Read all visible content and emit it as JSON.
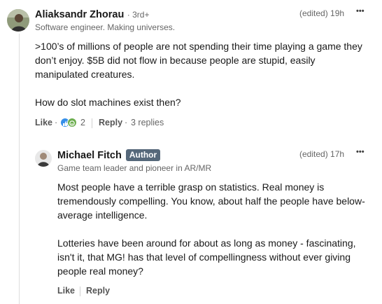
{
  "comment": {
    "author": "Aliaksandr Zhorau",
    "degree": "3rd+",
    "headline": "Software engineer. Making universes.",
    "edited_time": "(edited) 19h",
    "paragraphs": [
      ">100’s of millions of people are not spending their time playing a game they don’t enjoy. $5B did not flow in because people are stupid, easily manipulated creatures.",
      "How do slot machines exist then?"
    ],
    "actions": {
      "like": "Like",
      "dot1": "·",
      "reaction_count": "2",
      "reply": "Reply",
      "dot2": "·",
      "replies": "3 replies"
    },
    "reaction_icons": [
      "like-icon",
      "celebrate-icon"
    ],
    "menu_icon": "more-icon"
  },
  "reply": {
    "author": "Michael Fitch",
    "badge": "Author",
    "headline": "Game team leader and pioneer in AR/MR",
    "edited_time": "(edited) 17h",
    "paragraphs": [
      "Most people have a terrible grasp on statistics. Real money is tremendously compelling. You know, about half the people have below-average intelligence.",
      "Lotteries have been around for about as long as money - fascinating, isn't it, that MG! has that level of compellingness without ever giving people real money?"
    ],
    "actions": {
      "like": "Like",
      "reply": "Reply"
    },
    "menu_icon": "more-icon"
  },
  "colors": {
    "badge_bg": "#56687a",
    "like_blue": "#378fe9",
    "celebrate_green": "#6dae4f"
  },
  "more_glyph": "•••"
}
